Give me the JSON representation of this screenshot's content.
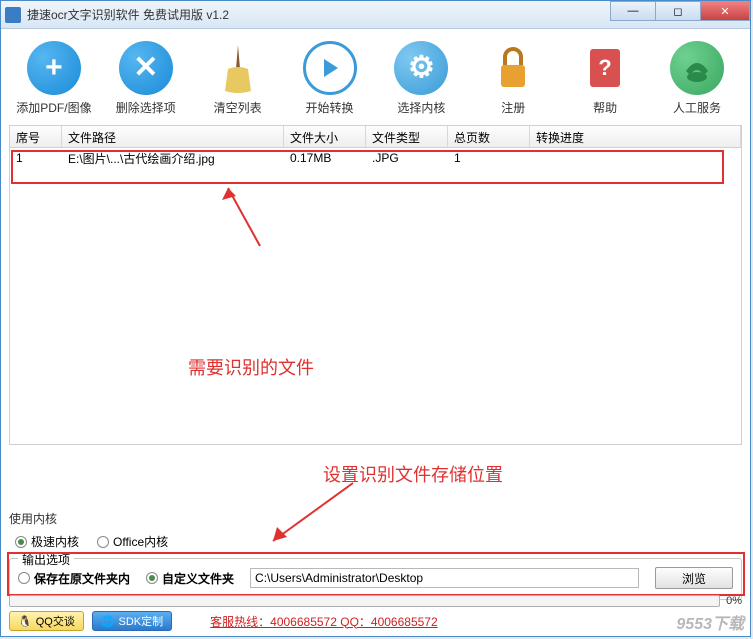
{
  "window": {
    "title": "捷速ocr文字识别软件 免费试用版 v1.2"
  },
  "toolbar": {
    "add": "添加PDF/图像",
    "delete": "删除选择项",
    "clear": "清空列表",
    "start": "开始转换",
    "kernel": "选择内核",
    "register": "注册",
    "help": "帮助",
    "service": "人工服务"
  },
  "table": {
    "headers": {
      "index": "席号",
      "path": "文件路径",
      "size": "文件大小",
      "type": "文件类型",
      "pages": "总页数",
      "progress": "转换进度"
    },
    "rows": [
      {
        "index": "1",
        "path": "E:\\图片\\...\\古代绘画介绍.jpg",
        "size": "0.17MB",
        "type": ".JPG",
        "pages": "1",
        "progress": ""
      }
    ]
  },
  "annotations": {
    "file_note": "需要识别的文件",
    "output_note": "设置识别文件存储位置"
  },
  "kernel": {
    "label": "使用内核",
    "fast": "极速内核",
    "office": "Office内核"
  },
  "output": {
    "legend": "输出选项",
    "same_folder": "保存在原文件夹内",
    "custom_folder": "自定义文件夹",
    "path": "C:\\Users\\Administrator\\Desktop",
    "browse": "浏览"
  },
  "progress": {
    "percent": "0%"
  },
  "footer": {
    "qq": "QQ交谈",
    "sdk": "SDK定制",
    "hotline": "客服热线：4006685572 QQ：4006685572"
  },
  "watermark": "9553下载"
}
